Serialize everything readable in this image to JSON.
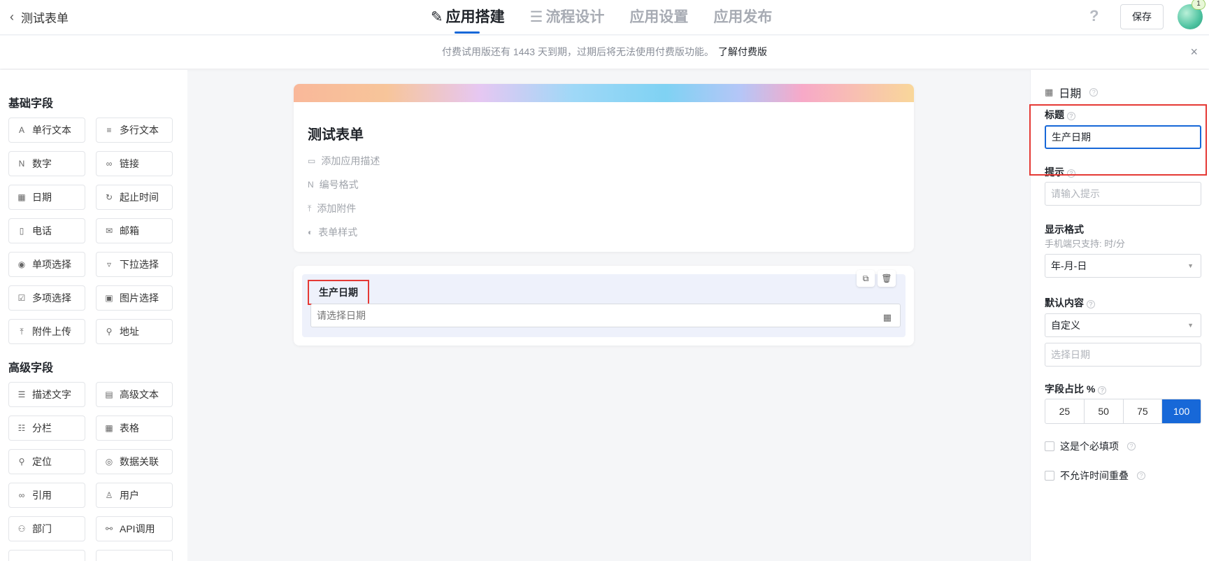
{
  "header": {
    "back_label": "测试表单",
    "tabs": [
      {
        "icon": "edit-icon",
        "label": "应用搭建"
      },
      {
        "icon": "list-icon",
        "label": "流程设计"
      },
      {
        "label": "应用设置"
      },
      {
        "label": "应用发布"
      }
    ],
    "help": "?",
    "save_label": "保存",
    "avatar_badge": "1"
  },
  "notice": {
    "text": "付费试用版还有 1443 天到期，过期后将无法使用付费版功能。",
    "link": "了解付费版",
    "close": "×"
  },
  "sidebar": {
    "basic_title": "基础字段",
    "basic_fields": [
      {
        "label": "单行文本",
        "icon": "single-text-icon"
      },
      {
        "label": "多行文本",
        "icon": "multi-text-icon"
      },
      {
        "label": "数字",
        "icon": "number-icon"
      },
      {
        "label": "链接",
        "icon": "link-icon"
      },
      {
        "label": "日期",
        "icon": "calendar-icon"
      },
      {
        "label": "起止时间",
        "icon": "time-range-icon"
      },
      {
        "label": "电话",
        "icon": "phone-icon"
      },
      {
        "label": "邮箱",
        "icon": "mail-icon"
      },
      {
        "label": "单项选择",
        "icon": "radio-icon"
      },
      {
        "label": "下拉选择",
        "icon": "dropdown-icon"
      },
      {
        "label": "多项选择",
        "icon": "checkbox-icon"
      },
      {
        "label": "图片选择",
        "icon": "image-icon"
      },
      {
        "label": "附件上传",
        "icon": "upload-icon"
      },
      {
        "label": "地址",
        "icon": "address-icon"
      }
    ],
    "advanced_title": "高级字段",
    "advanced_fields": [
      {
        "label": "描述文字",
        "icon": "description-icon"
      },
      {
        "label": "高级文本",
        "icon": "rich-text-icon"
      },
      {
        "label": "分栏",
        "icon": "columns-icon"
      },
      {
        "label": "表格",
        "icon": "table-icon"
      },
      {
        "label": "定位",
        "icon": "location-icon"
      },
      {
        "label": "数据关联",
        "icon": "data-link-icon"
      },
      {
        "label": "引用",
        "icon": "reference-icon"
      },
      {
        "label": "用户",
        "icon": "user-icon"
      },
      {
        "label": "部门",
        "icon": "department-icon"
      },
      {
        "label": "API调用",
        "icon": "api-icon"
      }
    ]
  },
  "form": {
    "title": "测试表单",
    "meta": [
      {
        "label": "添加应用描述",
        "icon": "description-icon"
      },
      {
        "label": "编号格式",
        "icon": "number-format-icon"
      },
      {
        "label": "添加附件",
        "icon": "upload-icon"
      },
      {
        "label": "表单样式",
        "icon": "palette-icon"
      }
    ],
    "field": {
      "label": "生产日期",
      "placeholder": "请选择日期"
    }
  },
  "panel": {
    "type_title": "日期",
    "title_label": "标题",
    "title_value": "生产日期",
    "hint_label": "提示",
    "hint_placeholder": "请输入提示",
    "format_label": "显示格式",
    "format_sub": "手机端只支持: 时/分",
    "format_value": "年-月-日",
    "default_label": "默认内容",
    "default_value": "自定义",
    "date_placeholder": "选择日期",
    "ratio_label": "字段占比 %",
    "ratio_options": [
      "25",
      "50",
      "75",
      "100"
    ],
    "ratio_selected": "100",
    "required_label": "这是个必填项",
    "no_overlap_label": "不允许时间重叠"
  },
  "colors": {
    "accent": "#1768d8",
    "highlight": "#e53935"
  }
}
